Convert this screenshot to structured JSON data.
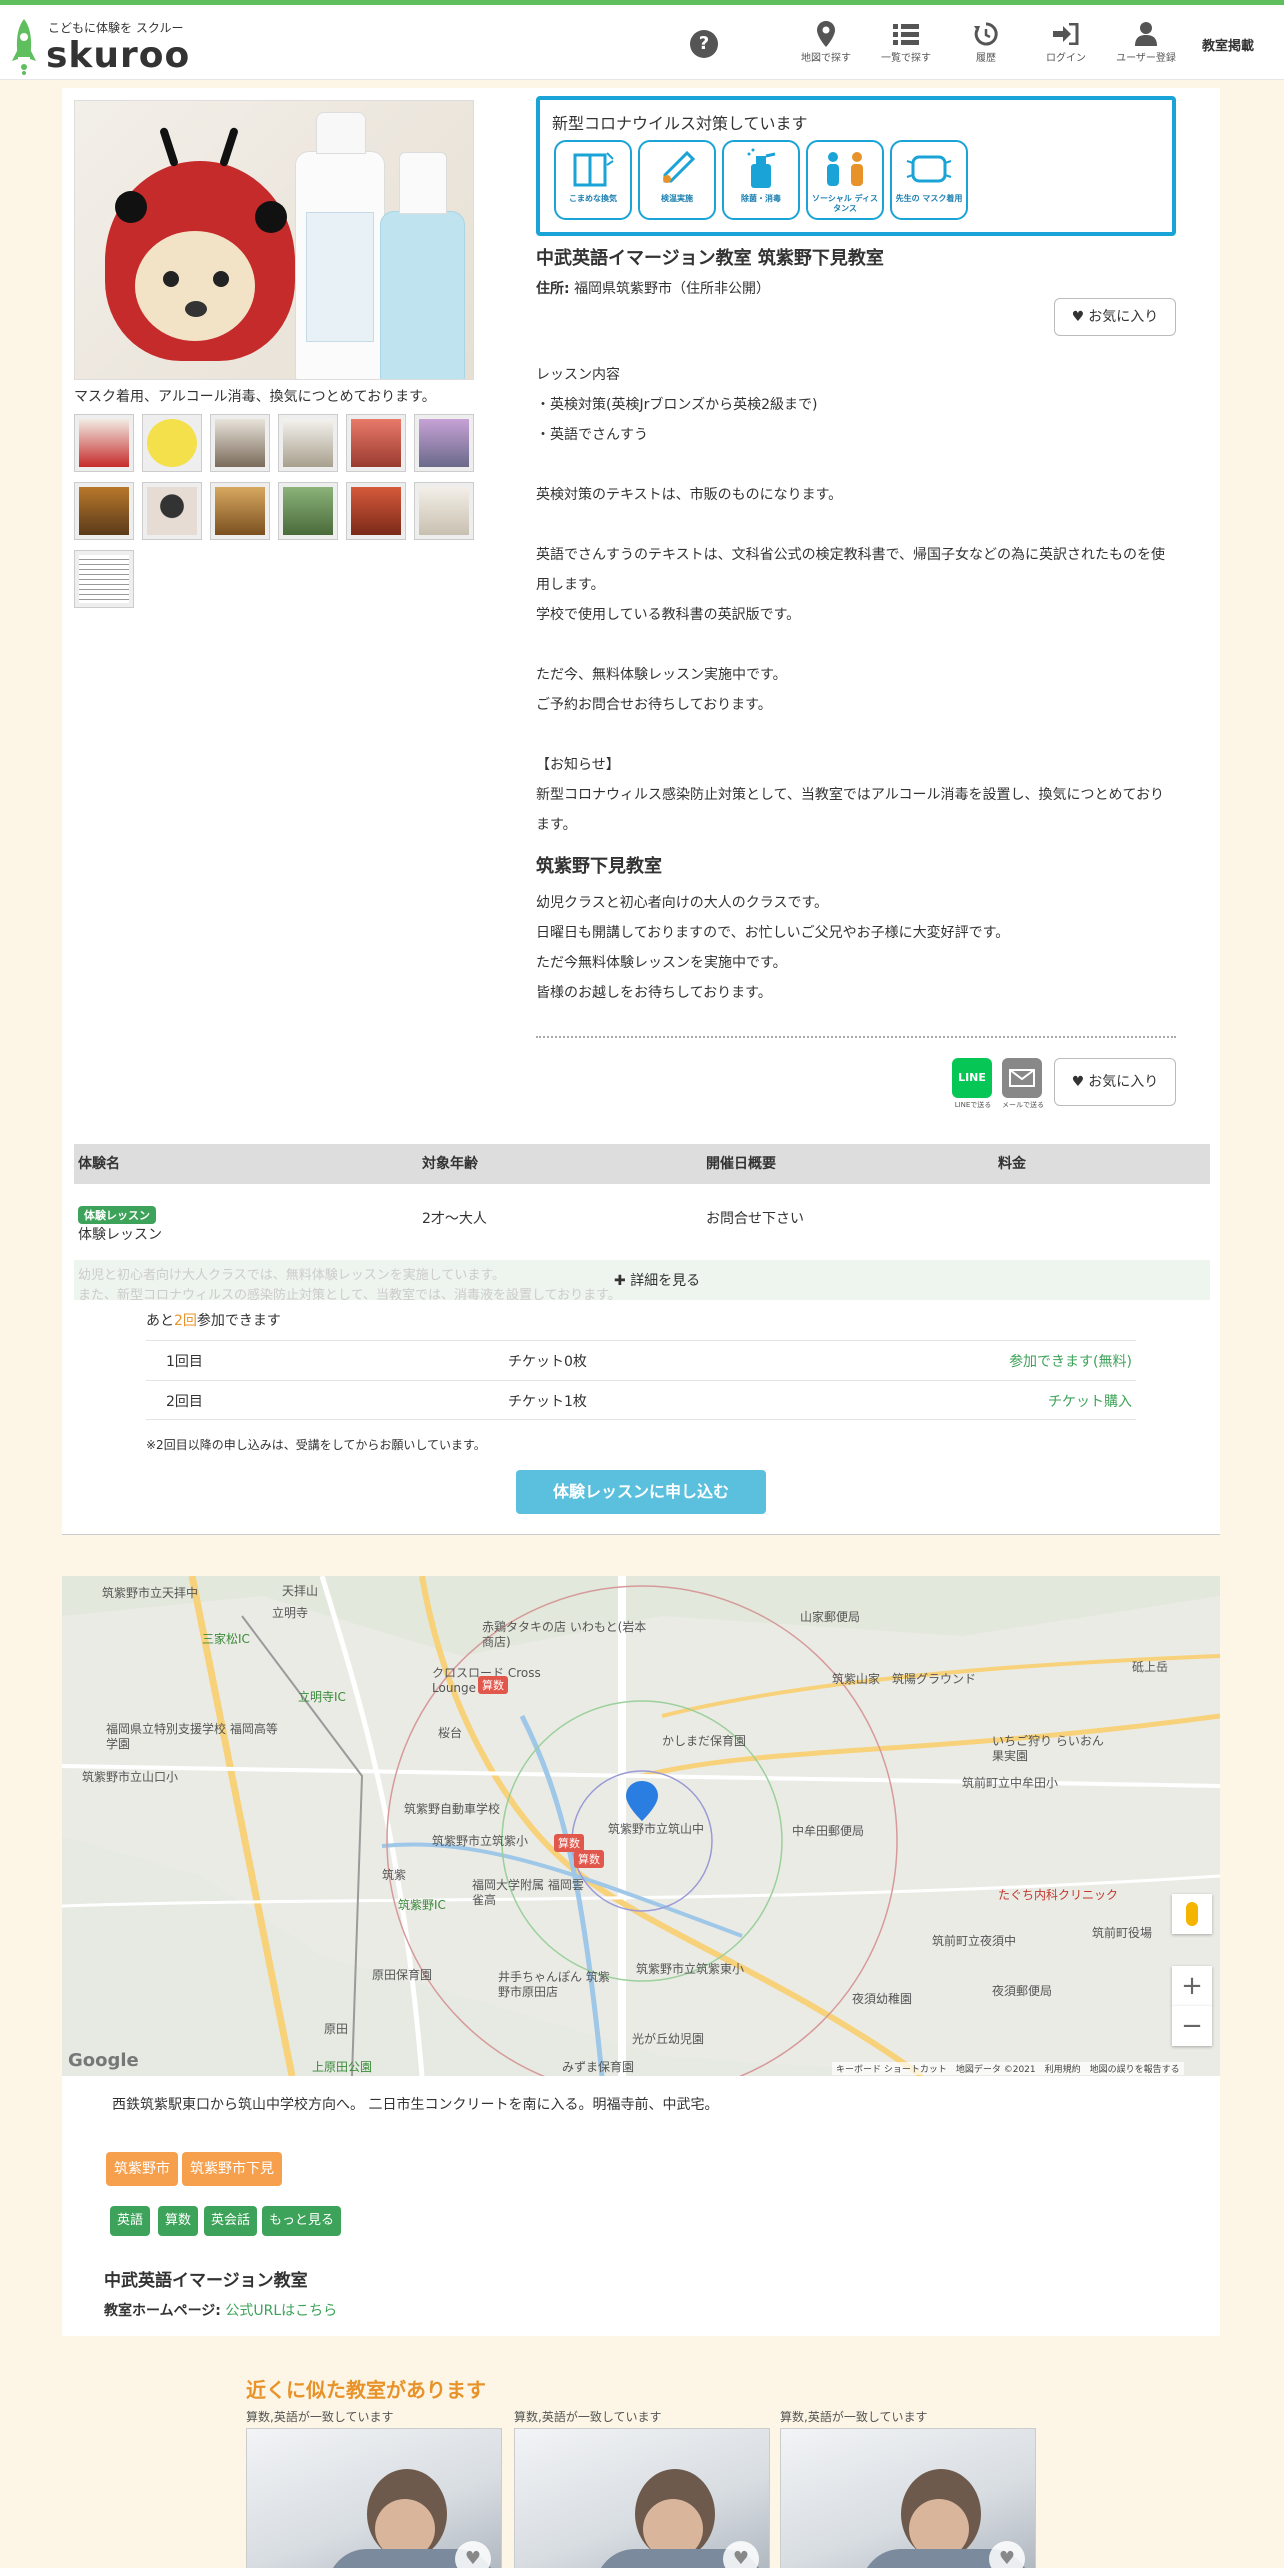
{
  "header": {
    "tagline": "こどもに体験を スクルー",
    "logo_text": "skuroo",
    "help_label": "?",
    "nav": [
      {
        "label": "地図で探す",
        "icon": "map-pin-icon"
      },
      {
        "label": "一覧で探す",
        "icon": "list-icon"
      },
      {
        "label": "履歴",
        "icon": "history-icon"
      },
      {
        "label": "ログイン",
        "icon": "login-icon"
      },
      {
        "label": "ユーザー登録",
        "icon": "user-icon"
      }
    ],
    "owner_link": "教室掲載"
  },
  "gallery": {
    "caption": "マスク着用、アルコール消毒、換気につとめております。"
  },
  "covid": {
    "title": "新型コロナウイルス対策しています",
    "icons": [
      "こまめな換気",
      "検温実施",
      "除菌・消毒",
      "ソーシャル ディスタンス",
      "先生の マスク着用"
    ]
  },
  "school": {
    "title": "中武英語イマージョン教室 筑紫野下見教室",
    "address_label": "住所:",
    "address_value": "福岡県筑紫野市（住所非公開）",
    "favorite": "お気に入り"
  },
  "description": [
    "レッスン内容",
    "・英検対策(英検Jrブロンズから英検2級まで)",
    "・英語でさんすう",
    "",
    "英検対策のテキストは、市販のものになります。",
    "",
    "英語でさんすうのテキストは、文科省公式の検定教科書で、帰国子女などの為に英訳されたものを使用します。",
    "学校で使用している教科書の英訳版です。",
    "",
    "ただ今、無料体験レッスン実施中です。",
    "ご予約お問合せお待ちしております。",
    "",
    "【お知らせ】",
    "新型コロナウィルス感染防止対策として、当教室ではアルコール消毒を設置し、換気につとめております。"
  ],
  "branch": {
    "title": "筑紫野下見教室",
    "lines": [
      "幼児クラスと初心者向けの大人のクラスです。",
      "日曜日も開講しておりますので、お忙しいご父兄やお子様に大変好評です。",
      "ただ今無料体験レッスンを実施中です。",
      "皆様のお越しをお待ちしております。"
    ]
  },
  "share": {
    "line_label": "LINE",
    "line_caption": "LINEで送る",
    "mail_caption": "メールで送る",
    "favorite": "お気に入り"
  },
  "table": {
    "headers": [
      "体験名",
      "対象年齢",
      "開催日概要",
      "料金"
    ],
    "row": {
      "badge": "体験レッスン",
      "name": "体験レッスン",
      "age": "2才〜大人",
      "schedule": "お問合せ下さい",
      "price": ""
    },
    "preview_lines": [
      "幼児と初心者向け大人クラスでは、無料体験レッスンを実施しています。",
      "また、新型コロナウィルスの感染防止対策として、当教室では、消毒液を設置しております。"
    ],
    "more": "詳細を見る"
  },
  "tickets": {
    "remain_prefix": "あと",
    "remain_num": "2回",
    "remain_suffix": "参加できます",
    "rows": [
      {
        "times": "1回目",
        "ticket": "チケット0枚",
        "status": "参加できます(無料)"
      },
      {
        "times": "2回目",
        "ticket": "チケット1枚",
        "status": "チケット購入"
      }
    ],
    "note": "※2回目以降の申し込みは、受講をしてからお願いしています。",
    "apply": "体験レッスンに申し込む"
  },
  "map": {
    "labels": [
      {
        "text": "筑紫野市立天拝中",
        "cls": ""
      },
      {
        "text": "天拝山",
        "cls": ""
      },
      {
        "text": "立明寺",
        "cls": ""
      },
      {
        "text": "三家松IC",
        "cls": "green"
      },
      {
        "text": "立明寺IC",
        "cls": "green"
      },
      {
        "text": "福岡県立特別支援学校 福岡高等学園",
        "cls": ""
      },
      {
        "text": "筑紫野市立山口小",
        "cls": ""
      },
      {
        "text": "赤鶏タタキの店 いわもと(岩本商店)",
        "cls": ""
      },
      {
        "text": "クロスロード Cross Lounge",
        "cls": ""
      },
      {
        "text": "桜台",
        "cls": ""
      },
      {
        "text": "筑紫野自動車学校",
        "cls": ""
      },
      {
        "text": "筑紫野市立筑紫小",
        "cls": ""
      },
      {
        "text": "筑紫野市立筑山中",
        "cls": ""
      },
      {
        "text": "筑紫野IC",
        "cls": "green"
      },
      {
        "text": "筑紫",
        "cls": ""
      },
      {
        "text": "福岡大学附属 福岡雲雀高",
        "cls": ""
      },
      {
        "text": "原田保育園",
        "cls": ""
      },
      {
        "text": "井手ちゃんぽん 筑紫野市原田店",
        "cls": ""
      },
      {
        "text": "筑紫野市立筑紫東小",
        "cls": ""
      },
      {
        "text": "光が丘幼児園",
        "cls": ""
      },
      {
        "text": "原田",
        "cls": ""
      },
      {
        "text": "上原田公園",
        "cls": "green"
      },
      {
        "text": "山家郵便局",
        "cls": ""
      },
      {
        "text": "筑紫山家",
        "cls": ""
      },
      {
        "text": "筑陽グラウンド",
        "cls": ""
      },
      {
        "text": "砥上岳",
        "cls": ""
      },
      {
        "text": "いちご狩り らいおん果実園",
        "cls": ""
      },
      {
        "text": "筑前町立中牟田小",
        "cls": ""
      },
      {
        "text": "中牟田郵便局",
        "cls": ""
      },
      {
        "text": "たぐち内科クリニック",
        "cls": "red"
      },
      {
        "text": "筑前町立夜須中",
        "cls": ""
      },
      {
        "text": "筑前町役場",
        "cls": ""
      },
      {
        "text": "夜須幼稚園",
        "cls": ""
      },
      {
        "text": "夜須郵便局",
        "cls": ""
      },
      {
        "text": "かしまだ保育園",
        "cls": ""
      },
      {
        "text": "みずま保育園",
        "cls": ""
      }
    ],
    "pins": [
      "算数",
      "算数",
      "算数"
    ],
    "google": "Google",
    "attribution": "キーボード ショートカット　地図データ ©2021　利用規約　地図の誤りを報告する",
    "zoom_in": "+",
    "zoom_out": "−"
  },
  "access": "西鉄筑紫駅東口から筑山中学校方向へ。 二日市生コンクリートを南に入る。明福寺前、中武宅。",
  "area_tags": [
    "筑紫野市",
    "筑紫野市下見"
  ],
  "category_tags": [
    "英語",
    "算数",
    "英会話",
    "もっと見る"
  ],
  "org": {
    "name": "中武英語イマージョン教室",
    "hp_label": "教室ホームページ:",
    "hp_link": "公式URLはこちら"
  },
  "similar": {
    "title": "近くに似た教室があります",
    "cards": [
      {
        "label": "算数,英語が一致しています"
      },
      {
        "label": "算数,英語が一致しています"
      },
      {
        "label": "算数,英語が一致しています"
      }
    ]
  },
  "colors": {
    "brand_green": "#5fbf5f",
    "covid_blue": "#1aa3d6",
    "apply_blue": "#5bc0de",
    "tag_orange": "#f6a04d",
    "tag_green": "#3ea35a",
    "accent_orange": "#e8932a"
  }
}
